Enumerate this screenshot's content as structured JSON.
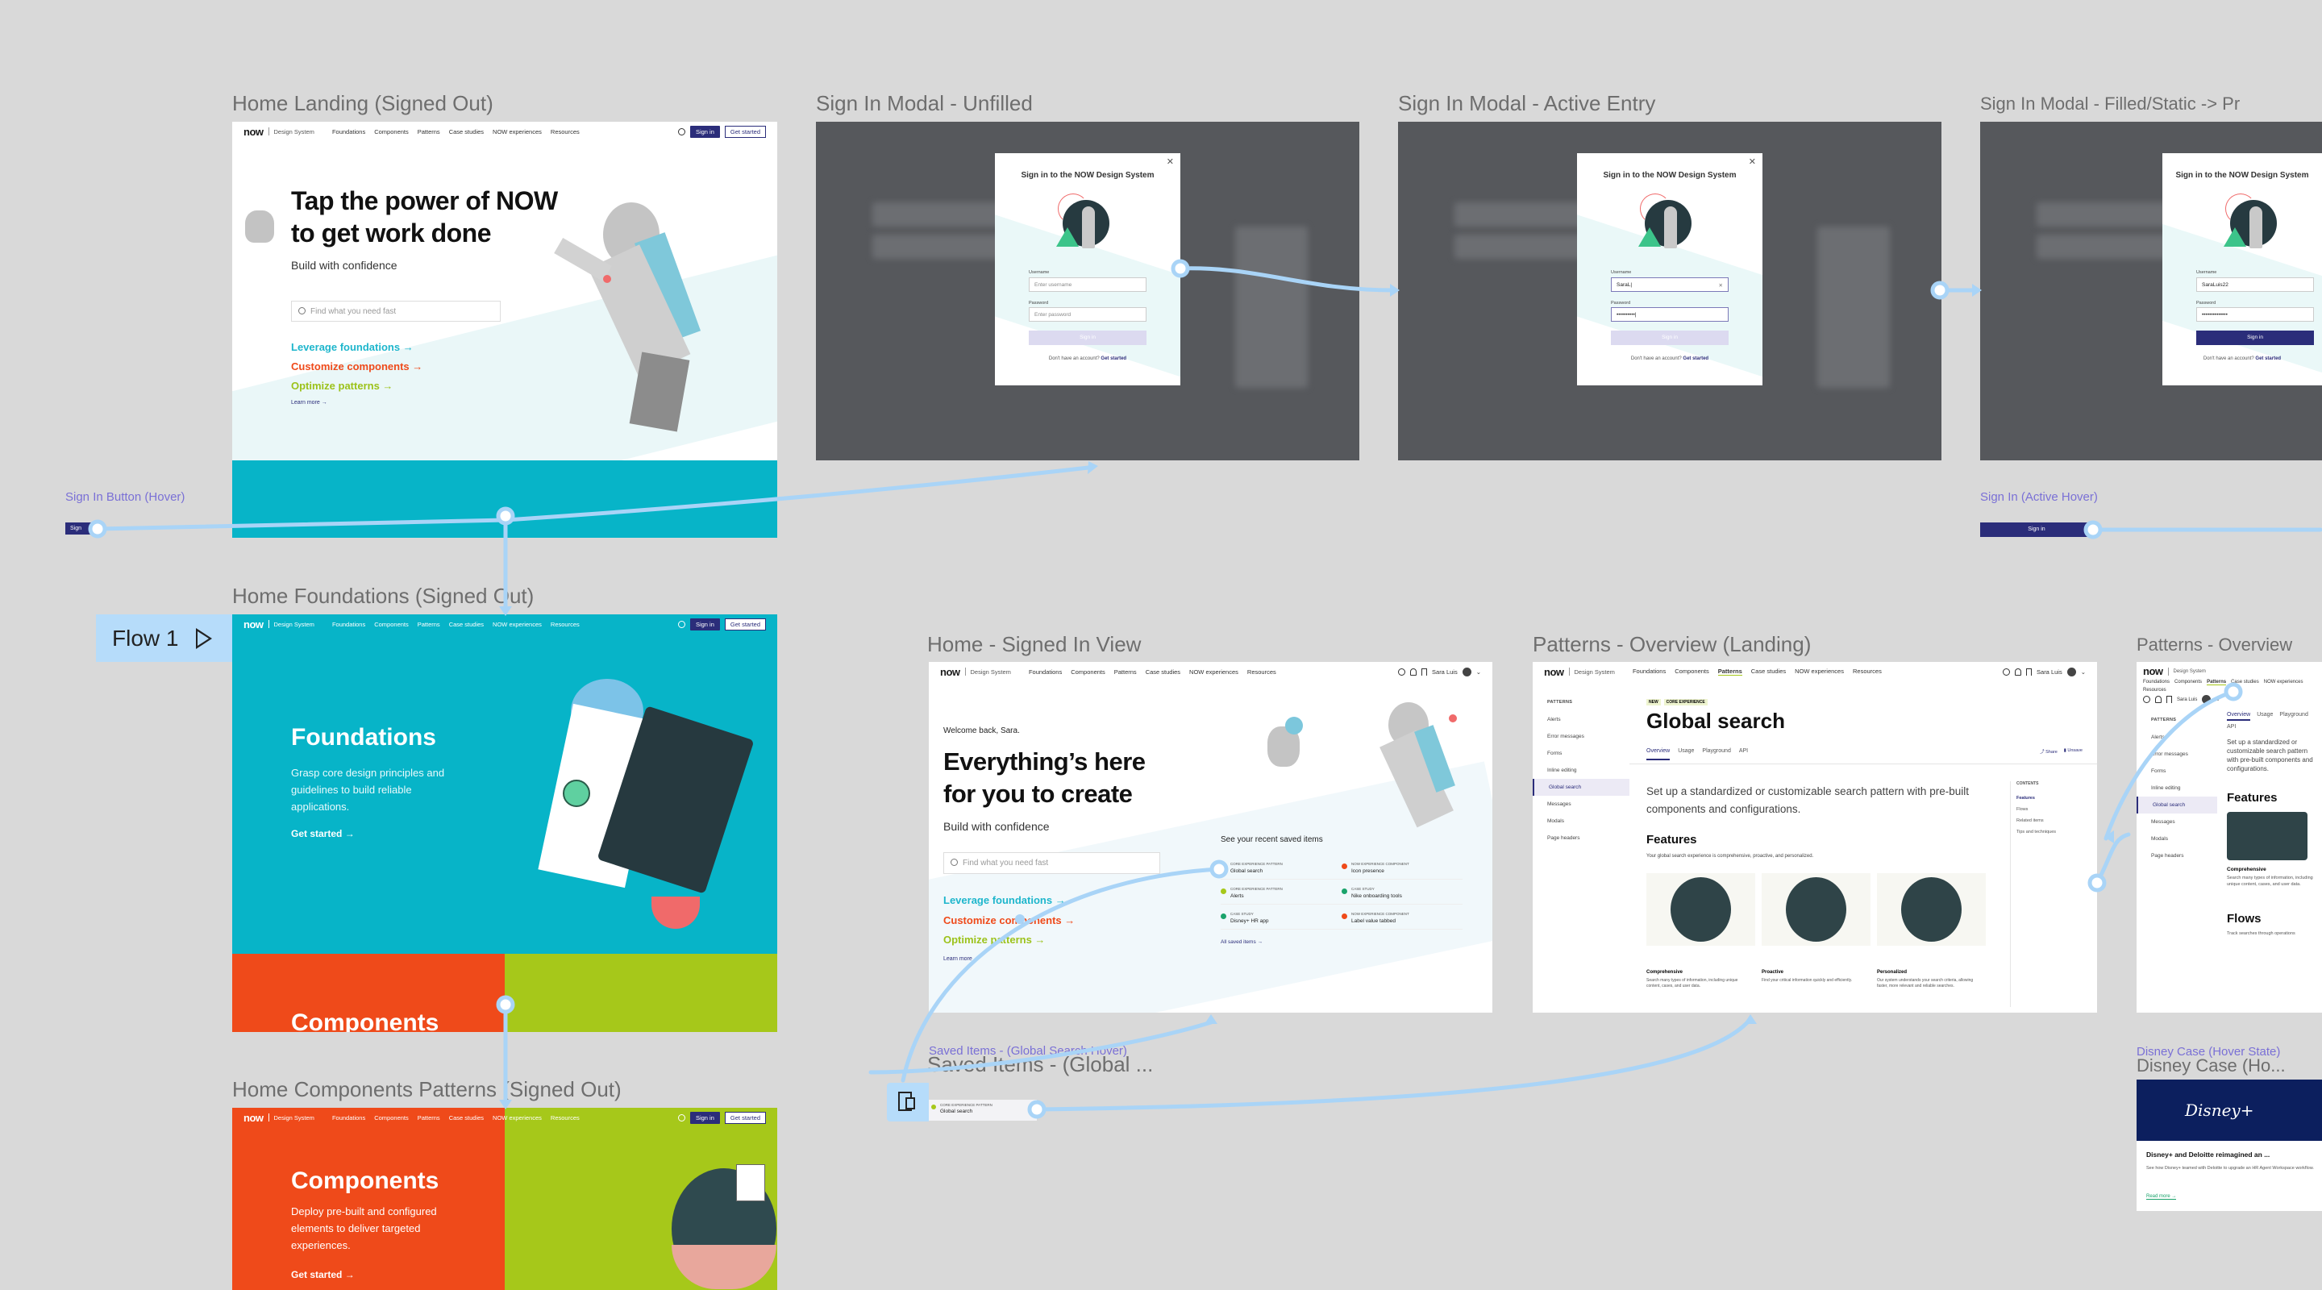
{
  "flow": {
    "label": "Flow 1"
  },
  "nav": {
    "logo": "now",
    "product": "Design System",
    "items": [
      "Foundations",
      "Components",
      "Patterns",
      "Case studies",
      "NOW experiences",
      "Resources"
    ],
    "sign_in": "Sign in",
    "get_started": "Get started",
    "user": "Sara Luis"
  },
  "hover_states": {
    "sign_in_button_hover": {
      "label": "Sign In Button (Hover)",
      "button": "Sign"
    },
    "sign_in_active_hover": {
      "label": "Sign In (Active Hover)",
      "button": "Sign in"
    }
  },
  "home_landing": {
    "title": "Home Landing (Signed Out)",
    "headline_1": "Tap the power of NOW",
    "headline_2": "to get work done",
    "subhead": "Build with confidence",
    "search_placeholder": "Find what you need fast",
    "links": [
      "Leverage foundations",
      "Customize components",
      "Optimize patterns"
    ],
    "learn_more": "Learn more"
  },
  "modal": {
    "heading": "Sign in to the NOW Design System",
    "username_label": "Username",
    "username_placeholder": "Enter username",
    "password_label": "Password",
    "password_placeholder": "Enter password",
    "button": "Sign in",
    "no_account": "Don't have an account?",
    "get_started": "Get started"
  },
  "signin_unfilled": {
    "title": "Sign In Modal - Unfilled"
  },
  "signin_active": {
    "title": "Sign In Modal - Active Entry",
    "username": "SaraL|",
    "password": "••••••••••|"
  },
  "signin_filled": {
    "title": "Sign In Modal - Filled/Static -> Pr",
    "username": "SaraLuis22",
    "password": "••••••••••••••"
  },
  "home_foundations": {
    "title": "Home Foundations (Signed Out)",
    "heading": "Foundations",
    "description": "Grasp core design principles and guidelines to build reliable applications.",
    "cta": "Get started",
    "next_heading": "Components"
  },
  "home_components": {
    "title": "Home Components Patterns (Signed Out)",
    "heading": "Components",
    "description": "Deploy pre-built and configured elements to deliver targeted experiences.",
    "cta": "Get started"
  },
  "home_signed_in": {
    "title": "Home - Signed In View",
    "welcome": "Welcome back, Sara.",
    "headline_1": "Everything’s here",
    "headline_2": "for you to create",
    "subhead": "Build with confidence",
    "search_placeholder": "Find what you need fast",
    "links": [
      "Leverage foundations",
      "Customize components",
      "Optimize patterns"
    ],
    "learn_more": "Learn more",
    "saved_heading": "See your recent saved items",
    "saved_items": [
      {
        "category": "CORE EXPERIENCE PATTERN",
        "name": "Global search",
        "color": "#a6c81a"
      },
      {
        "category": "NOW EXPERIENCE COMPONENT",
        "name": "Icon presence",
        "color": "#ef4a1a"
      },
      {
        "category": "CORE EXPERIENCE PATTERN",
        "name": "Alerts",
        "color": "#a6c81a"
      },
      {
        "category": "CASE STUDY",
        "name": "Nike onboarding tools",
        "color": "#1aa36b"
      },
      {
        "category": "CASE STUDY",
        "name": "Disney+ HR app",
        "color": "#1aa36b"
      },
      {
        "category": "NOW EXPERIENCE COMPONENT",
        "name": "Label value tabbed",
        "color": "#ef4a1a"
      }
    ],
    "all_saved": "All saved items"
  },
  "patterns_overview": {
    "title": "Patterns - Overview (Landing)",
    "sidebar_heading": "PATTERNS",
    "sidebar_items": [
      "Alerts",
      "Error messages",
      "Forms",
      "Inline editing",
      "Global search",
      "Messages",
      "Modals",
      "Page headers"
    ],
    "active_item": "Global search",
    "badges": [
      "NEW",
      "CORE EXPERIENCE"
    ],
    "page_title": "Global search",
    "tabs": [
      "Overview",
      "Usage",
      "Playground",
      "API"
    ],
    "share": "Share",
    "unsave": "Unsave",
    "intro": "Set up a standardized or customizable search pattern with pre-built components and configurations.",
    "features_heading": "Features",
    "features_desc": "Your global search experience is comprehensive, proactive, and personalized.",
    "features": [
      {
        "name": "Comprehensive",
        "desc": "Search many types of information, including unique content, cases, and user data."
      },
      {
        "name": "Proactive",
        "desc": "Find your critical information quickly and efficiently."
      },
      {
        "name": "Personalized",
        "desc": "Our system understands your search criteria, allowing faster, more relevant and reliable searches."
      }
    ],
    "contents_heading": "CONTENTS",
    "contents": [
      "Features",
      "Flows",
      "Related items",
      "Tips and techniques"
    ]
  },
  "patterns_overview_2": {
    "title": "Patterns - Overview",
    "intro": "Set up a standardized or customizable search pattern with pre-built components and configurations.",
    "flows_heading": "Flows",
    "flows_desc": "Track searches through operations"
  },
  "saved_items_hover": {
    "label": "Saved Items - (Global Search Hover)",
    "title": "Saved Items - (Global ...",
    "category": "CORE EXPERIENCE PATTERN",
    "name": "Global search"
  },
  "disney_case": {
    "label": "Disney Case (Hover State)",
    "title": "Disney Case (Ho...",
    "logo": "Disney+",
    "card_title": "Disney+ and Deloitte reimagined an ...",
    "card_desc": "See how Disney+ teamed with Deloitte to upgrade an HR Agent Workspace workflow.",
    "read_more": "Read more"
  },
  "colors": {
    "canvas": "#d9d9d9",
    "connector": "#a9d4f7",
    "brand": "#2b2d7a",
    "teal": "#07b4c8",
    "orange": "#ef4a1a",
    "green": "#a6c81a",
    "label": "#7a70d6"
  }
}
